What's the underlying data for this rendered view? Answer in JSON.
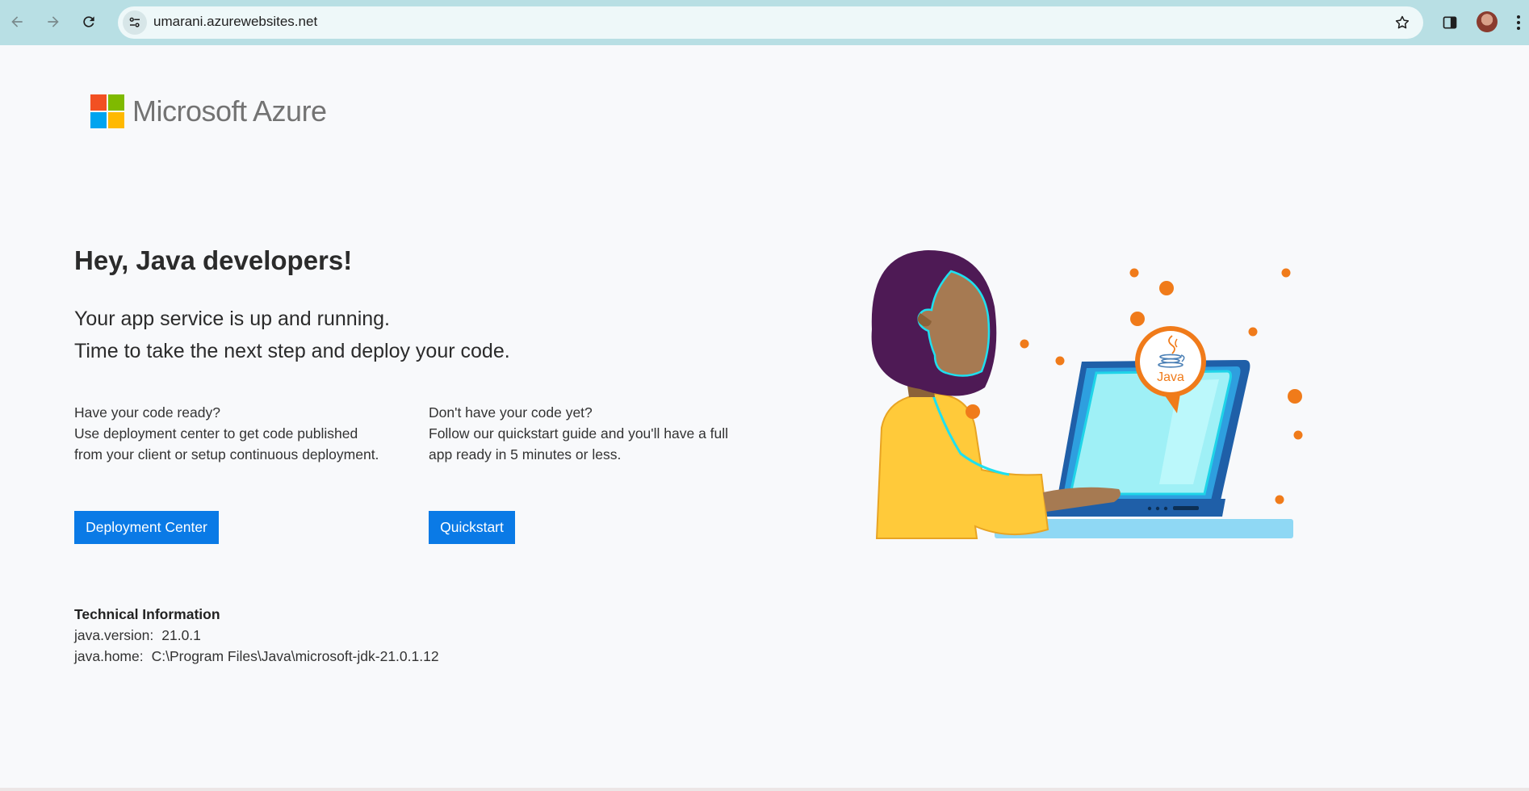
{
  "browser": {
    "url": "umarani.azurewebsites.net"
  },
  "logo": {
    "text": "Microsoft Azure",
    "colors": [
      "#f25022",
      "#7fba00",
      "#00a4ef",
      "#ffb900"
    ]
  },
  "main": {
    "headline": "Hey, Java developers!",
    "subline_1": "Your app service is up and running.",
    "subline_2": "Time to take the next step and deploy your code.",
    "left": {
      "question": "Have your code ready?",
      "text": "Use deployment center to get code published from your client or setup continuous deployment.",
      "button": "Deployment Center"
    },
    "right": {
      "question": "Don't have your code yet?",
      "text": "Follow our quickstart guide and you'll have a full app ready in 5 minutes or less.",
      "button": "Quickstart"
    }
  },
  "tech": {
    "title": "Technical Information",
    "java_version_key": "java.version:",
    "java_version": "21.0.1",
    "java_home_key": "java.home:",
    "java_home": "C:\\Program Files\\Java\\microsoft-jdk-21.0.1.12"
  },
  "illustration": {
    "badge_text": "Java"
  },
  "colors": {
    "accent": "#0078d4",
    "browser_bar": "#b8dfe4"
  }
}
